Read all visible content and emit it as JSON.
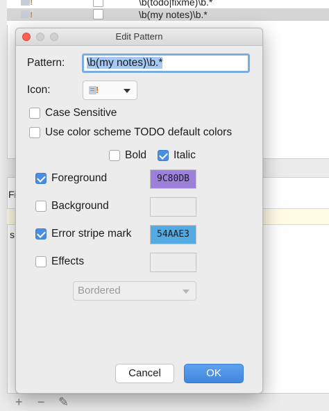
{
  "background": {
    "rows": [
      {
        "text": "\\b(todo|fixme)\\b.*",
        "checked": false
      },
      {
        "text": "\\b(my notes)\\b.*",
        "checked": false
      }
    ],
    "label_fi": "Fi",
    "label_s": "s",
    "toolbar": {
      "add": "+",
      "remove": "−",
      "edit": "✎"
    }
  },
  "dialog": {
    "title": "Edit Pattern",
    "pattern_label": "Pattern:",
    "pattern_value": "\\b(my notes)\\b.*",
    "icon_label": "Icon:",
    "icon_name": "todo-icon",
    "case_sensitive": {
      "label": "Case Sensitive",
      "checked": false
    },
    "use_color_scheme": {
      "label": "Use color scheme TODO default colors",
      "checked": false
    },
    "bold": {
      "label": "Bold",
      "checked": false
    },
    "italic": {
      "label": "Italic",
      "checked": true
    },
    "foreground": {
      "label": "Foreground",
      "checked": true,
      "color": "9C80DB",
      "hex": "#9C80DB"
    },
    "background": {
      "label": "Background",
      "checked": false,
      "color": ""
    },
    "error_stripe": {
      "label": "Error stripe mark",
      "checked": true,
      "color": "54AAE3",
      "hex": "#54AAE3"
    },
    "effects": {
      "label": "Effects",
      "checked": false,
      "color": ""
    },
    "effect_type": {
      "selected": "Bordered"
    },
    "buttons": {
      "cancel": "Cancel",
      "ok": "OK"
    }
  },
  "colors": {
    "accent": "#4a8fdf",
    "close_button": "#fc5f57"
  }
}
